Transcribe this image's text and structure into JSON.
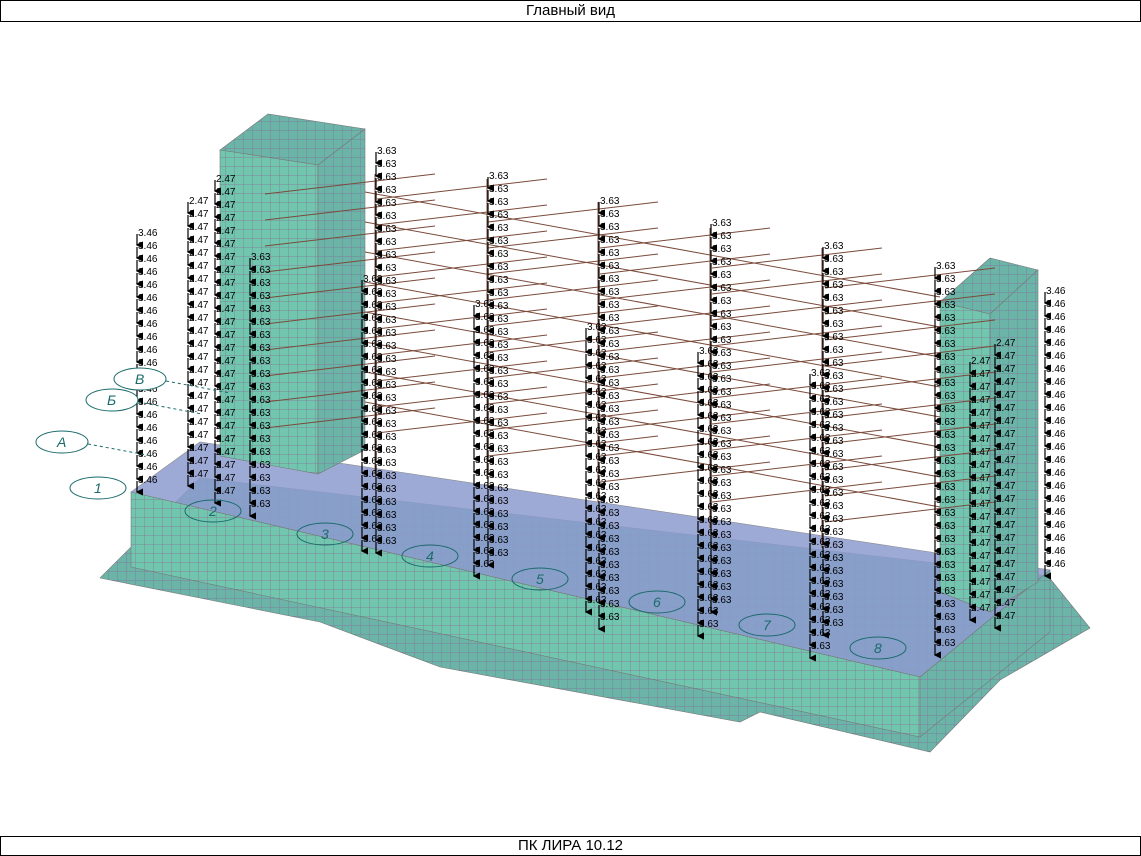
{
  "window": {
    "title": "Главный вид"
  },
  "status": {
    "text": "ПК ЛИРА 10.12"
  },
  "colors": {
    "mesh_fill": "#72c6b0",
    "mesh_line": "#7a7a7a",
    "node": "#ff33ff",
    "frame": "#7a4a3a",
    "axis": "#1a6b6b",
    "load": "#000000"
  },
  "axes": {
    "letters": [
      "А",
      "Б",
      "В"
    ],
    "numbers": [
      "1",
      "2",
      "3",
      "4",
      "5",
      "6",
      "7",
      "8"
    ]
  },
  "loads": {
    "column_value": "3.63",
    "left_edge_value": "3.46",
    "mid_edge_value": "2.47"
  }
}
